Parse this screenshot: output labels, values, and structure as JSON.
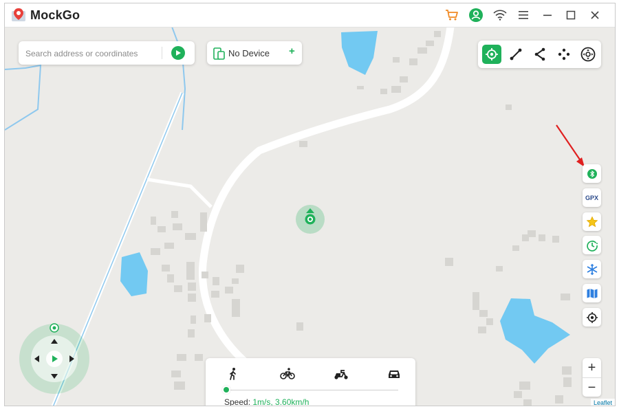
{
  "app": {
    "title": "MockGo"
  },
  "titlebar": {
    "icons": [
      "cart-icon",
      "user-icon",
      "wifi-icon",
      "menu-icon",
      "minimize-icon",
      "maximize-icon",
      "close-icon"
    ]
  },
  "search": {
    "placeholder": "Search address or coordinates",
    "value": ""
  },
  "device": {
    "label": "No Device",
    "add_label": "+"
  },
  "modes": [
    "teleport-mode-icon",
    "two-spot-mode-icon",
    "multi-spot-mode-icon",
    "jump-teleport-icon",
    "joystick-mode-icon"
  ],
  "side_toolbar": {
    "items": [
      "bluetooth-icon",
      "gpx-icon",
      "favorites-icon",
      "history-icon",
      "freeze-icon",
      "map-icon",
      "locate-icon"
    ],
    "gpx_label": "GPX"
  },
  "zoom": {
    "in_label": "+",
    "out_label": "−"
  },
  "speed_panel": {
    "transport": [
      "walk-icon",
      "bike-icon",
      "scooter-icon",
      "car-icon"
    ],
    "speed_label": "Speed: ",
    "speed_value": "1m/s, 3.60km/h",
    "slider_fraction": 0
  },
  "attribution": "Leaflet",
  "colors": {
    "accent": "#1fb15a",
    "water": "#72c9f2",
    "road": "#ffffff",
    "map_bg": "#ecebe8",
    "annotation_arrow": "#e02020"
  }
}
